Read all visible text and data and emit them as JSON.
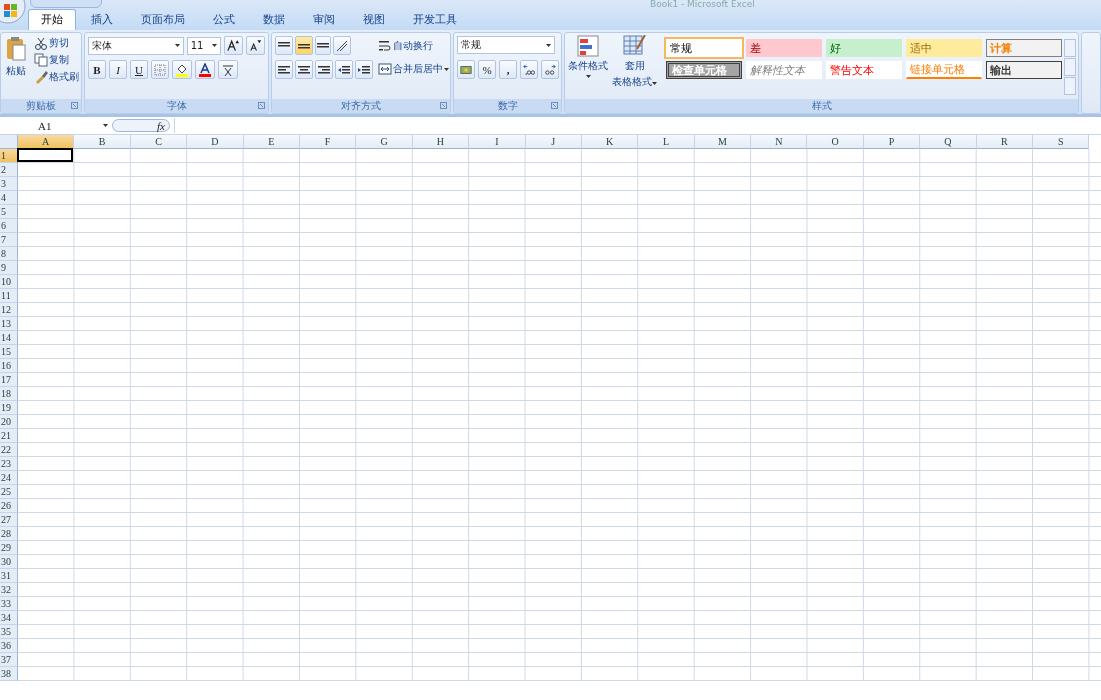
{
  "window": {
    "title": "Book1 - Microsoft Excel"
  },
  "tabs": [
    {
      "label": "开始",
      "selected": true
    },
    {
      "label": "插入",
      "selected": false
    },
    {
      "label": "页面布局",
      "selected": false
    },
    {
      "label": "公式",
      "selected": false
    },
    {
      "label": "数据",
      "selected": false
    },
    {
      "label": "审阅",
      "selected": false
    },
    {
      "label": "视图",
      "selected": false
    },
    {
      "label": "开发工具",
      "selected": false
    }
  ],
  "clipboard": {
    "paste": "粘贴",
    "cut": "剪切",
    "copy": "复制",
    "format_painter": "格式刷",
    "label": "剪贴板"
  },
  "font": {
    "name": "宋体",
    "size": "11",
    "bold": "B",
    "italic": "I",
    "underline": "U",
    "label": "字体"
  },
  "alignment": {
    "wrap": "自动换行",
    "merge": "合并后居中",
    "label": "对齐方式",
    "vertical_middle_selected": true
  },
  "number": {
    "format": "常规",
    "percent": "%",
    "comma": ",",
    "label": "数字"
  },
  "styles": {
    "conditional": "条件格式",
    "table_format_1": "套用",
    "table_format_2": "表格格式",
    "label": "样式",
    "cells": [
      {
        "label": "常规",
        "kind": "normal",
        "selected": true
      },
      {
        "label": "差",
        "kind": "bad",
        "selected": false
      },
      {
        "label": "好",
        "kind": "good",
        "selected": false
      },
      {
        "label": "适中",
        "kind": "neutral",
        "selected": false
      },
      {
        "label": "计算",
        "kind": "calculation",
        "selected": false
      },
      {
        "label": "检查单元格",
        "kind": "check",
        "selected": false
      },
      {
        "label": "解释性文本",
        "kind": "explanatory",
        "selected": false
      },
      {
        "label": "警告文本",
        "kind": "warning",
        "selected": false
      },
      {
        "label": "链接单元格",
        "kind": "linked",
        "selected": false
      },
      {
        "label": "输出",
        "kind": "output",
        "selected": false
      }
    ]
  },
  "formula_bar": {
    "name_box": "A1",
    "fx": "fx"
  },
  "columns": [
    {
      "label": "A",
      "selected": true
    },
    {
      "label": "B",
      "selected": false
    },
    {
      "label": "C",
      "selected": false
    },
    {
      "label": "D",
      "selected": false
    },
    {
      "label": "E",
      "selected": false
    },
    {
      "label": "F",
      "selected": false
    },
    {
      "label": "G",
      "selected": false
    },
    {
      "label": "H",
      "selected": false
    },
    {
      "label": "I",
      "selected": false
    },
    {
      "label": "J",
      "selected": false
    },
    {
      "label": "K",
      "selected": false
    },
    {
      "label": "L",
      "selected": false
    },
    {
      "label": "M",
      "selected": false
    },
    {
      "label": "N",
      "selected": false
    },
    {
      "label": "O",
      "selected": false
    },
    {
      "label": "P",
      "selected": false
    },
    {
      "label": "Q",
      "selected": false
    },
    {
      "label": "R",
      "selected": false
    },
    {
      "label": "S",
      "selected": false
    }
  ],
  "rows": [
    {
      "label": "1",
      "selected": true
    },
    {
      "label": "2",
      "selected": false
    },
    {
      "label": "3",
      "selected": false
    },
    {
      "label": "4",
      "selected": false
    },
    {
      "label": "5",
      "selected": false
    },
    {
      "label": "6",
      "selected": false
    },
    {
      "label": "7",
      "selected": false
    },
    {
      "label": "8",
      "selected": false
    },
    {
      "label": "9",
      "selected": false
    },
    {
      "label": "10",
      "selected": false
    },
    {
      "label": "11",
      "selected": false
    },
    {
      "label": "12",
      "selected": false
    },
    {
      "label": "13",
      "selected": false
    },
    {
      "label": "14",
      "selected": false
    },
    {
      "label": "15",
      "selected": false
    },
    {
      "label": "16",
      "selected": false
    },
    {
      "label": "17",
      "selected": false
    },
    {
      "label": "18",
      "selected": false
    },
    {
      "label": "19",
      "selected": false
    },
    {
      "label": "20",
      "selected": false
    },
    {
      "label": "21",
      "selected": false
    },
    {
      "label": "22",
      "selected": false
    },
    {
      "label": "23",
      "selected": false
    },
    {
      "label": "24",
      "selected": false
    },
    {
      "label": "25",
      "selected": false
    },
    {
      "label": "26",
      "selected": false
    },
    {
      "label": "27",
      "selected": false
    },
    {
      "label": "28",
      "selected": false
    },
    {
      "label": "29",
      "selected": false
    },
    {
      "label": "30",
      "selected": false
    },
    {
      "label": "31",
      "selected": false
    },
    {
      "label": "32",
      "selected": false
    },
    {
      "label": "33",
      "selected": false
    },
    {
      "label": "34",
      "selected": false
    },
    {
      "label": "35",
      "selected": false
    },
    {
      "label": "36",
      "selected": false
    },
    {
      "label": "37",
      "selected": false
    },
    {
      "label": "38",
      "selected": false
    }
  ]
}
